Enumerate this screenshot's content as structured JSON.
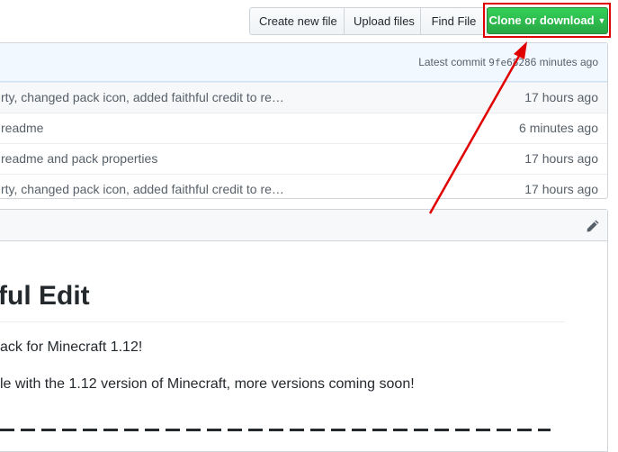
{
  "toolbar": {
    "create_new_file": "Create new file",
    "upload_files": "Upload files",
    "find_file": "Find File",
    "clone_or_download": "Clone or download"
  },
  "commit_bar": {
    "label": "Latest commit",
    "sha": "9fe6828",
    "age": "6 minutes ago"
  },
  "files": [
    {
      "message": "rty, changed pack icon, added faithful credit to re…",
      "age": "17 hours ago"
    },
    {
      "message": "readme",
      "age": "6 minutes ago"
    },
    {
      "message": "readme and pack properties",
      "age": "17 hours ago"
    },
    {
      "message": "rty, changed pack icon, added faithful credit to re…",
      "age": "17 hours ago"
    }
  ],
  "readme": {
    "title": "ful Edit",
    "paragraph1": "ack for Minecraft 1.12!",
    "paragraph2": "le with the 1.12 version of Minecraft, more versions coming soon!"
  },
  "colors": {
    "clone_button": "#2ea44f",
    "highlight_box": "#e00000",
    "annotation_arrow": "#e00000"
  }
}
